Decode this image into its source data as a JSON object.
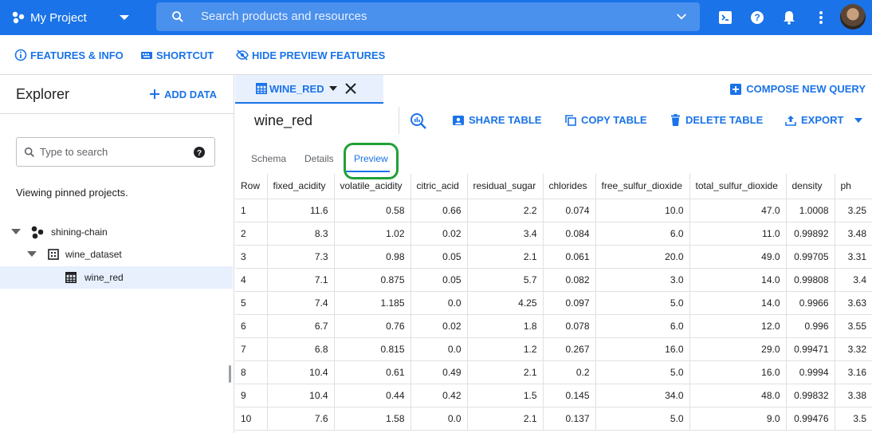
{
  "topbar": {
    "project_name": "My Project",
    "search_placeholder": "Search products and resources"
  },
  "actions": {
    "features_info": "FEATURES & INFO",
    "shortcut": "SHORTCUT",
    "hide_preview": "HIDE PREVIEW FEATURES"
  },
  "explorer": {
    "title": "Explorer",
    "add_data": "ADD DATA",
    "search_placeholder": "Type to search",
    "pinned_text": "Viewing pinned projects.",
    "tree": {
      "project": "shining-chain",
      "dataset": "wine_dataset",
      "table": "wine_red"
    }
  },
  "main": {
    "tab_label": "WINE_RED",
    "compose_query": "COMPOSE NEW QUERY",
    "table_title": "wine_red",
    "share_table": "SHARE TABLE",
    "copy_table": "COPY TABLE",
    "delete_table": "DELETE TABLE",
    "export": "EXPORT",
    "subtabs": {
      "schema": "Schema",
      "details": "Details",
      "preview": "Preview"
    }
  },
  "preview": {
    "columns": [
      "Row",
      "fixed_acidity",
      "volatile_acidity",
      "citric_acid",
      "residual_sugar",
      "chlorides",
      "free_sulfur_dioxide",
      "total_sulfur_dioxide",
      "density",
      "ph"
    ],
    "rows": [
      [
        "1",
        "11.6",
        "0.58",
        "0.66",
        "2.2",
        "0.074",
        "10.0",
        "47.0",
        "1.0008",
        "3.25"
      ],
      [
        "2",
        "8.3",
        "1.02",
        "0.02",
        "3.4",
        "0.084",
        "6.0",
        "11.0",
        "0.99892",
        "3.48"
      ],
      [
        "3",
        "7.3",
        "0.98",
        "0.05",
        "2.1",
        "0.061",
        "20.0",
        "49.0",
        "0.99705",
        "3.31"
      ],
      [
        "4",
        "7.1",
        "0.875",
        "0.05",
        "5.7",
        "0.082",
        "3.0",
        "14.0",
        "0.99808",
        "3.4"
      ],
      [
        "5",
        "7.4",
        "1.185",
        "0.0",
        "4.25",
        "0.097",
        "5.0",
        "14.0",
        "0.9966",
        "3.63"
      ],
      [
        "6",
        "6.7",
        "0.76",
        "0.02",
        "1.8",
        "0.078",
        "6.0",
        "12.0",
        "0.996",
        "3.55"
      ],
      [
        "7",
        "6.8",
        "0.815",
        "0.0",
        "1.2",
        "0.267",
        "16.0",
        "29.0",
        "0.99471",
        "3.32"
      ],
      [
        "8",
        "10.4",
        "0.61",
        "0.49",
        "2.1",
        "0.2",
        "5.0",
        "16.0",
        "0.9994",
        "3.16"
      ],
      [
        "9",
        "10.4",
        "0.44",
        "0.42",
        "1.5",
        "0.145",
        "34.0",
        "48.0",
        "0.99832",
        "3.38"
      ],
      [
        "10",
        "7.6",
        "1.58",
        "0.0",
        "2.1",
        "0.137",
        "5.0",
        "9.0",
        "0.99476",
        "3.5"
      ]
    ]
  },
  "colors": {
    "brand_blue": "#1a73e8",
    "highlight_green": "#21a038"
  }
}
